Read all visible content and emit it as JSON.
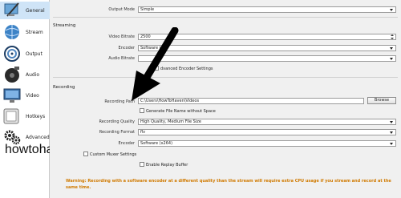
{
  "sidebar": {
    "items": [
      {
        "label": "General",
        "icon": "general-icon"
      },
      {
        "label": "Stream",
        "icon": "stream-icon"
      },
      {
        "label": "Output",
        "icon": "output-icon"
      },
      {
        "label": "Audio",
        "icon": "audio-icon"
      },
      {
        "label": "Video",
        "icon": "video-icon"
      },
      {
        "label": "Hotkeys",
        "icon": "hotkeys-icon"
      },
      {
        "label": "Advanced",
        "icon": "gears-icon"
      }
    ]
  },
  "output_mode": {
    "label": "Output Mode",
    "value": "Simple"
  },
  "streaming": {
    "title": "Streaming",
    "video_bitrate": {
      "label": "Video Bitrate",
      "value": "2500"
    },
    "encoder": {
      "label": "Encoder",
      "value": "Software (x"
    },
    "audio_bitrate": {
      "label": "Audio Bitrate",
      "value": ""
    },
    "advanced_encoder": {
      "label": "dvanced Encoder Settings"
    }
  },
  "recording": {
    "title": "Recording",
    "path": {
      "label": "Recording Path",
      "value": "C:\\Users\\HowToHaven\\Videos"
    },
    "browse_label": "Browse",
    "generate_name": {
      "label": "Generate File Name without Space"
    },
    "quality": {
      "label": "Recording Quality",
      "value": "High Quality, Medium File Size"
    },
    "format": {
      "label": "Recording Format",
      "value": "flv"
    },
    "encoder": {
      "label": "Encoder",
      "value": "Software (x264)"
    },
    "custom_muxer": {
      "label": "Custom Muxer Settings"
    },
    "replay_buffer": {
      "label": "Enable Replay Buffer"
    }
  },
  "warning": "Warning: Recording with a software encoder at a different quality than the stream will require extra CPU usage if you stream and record at the same time.",
  "watermark": "howtohaven.com",
  "colors": {
    "warning": "#d07a00",
    "active_nav": "#cfe4f7"
  }
}
